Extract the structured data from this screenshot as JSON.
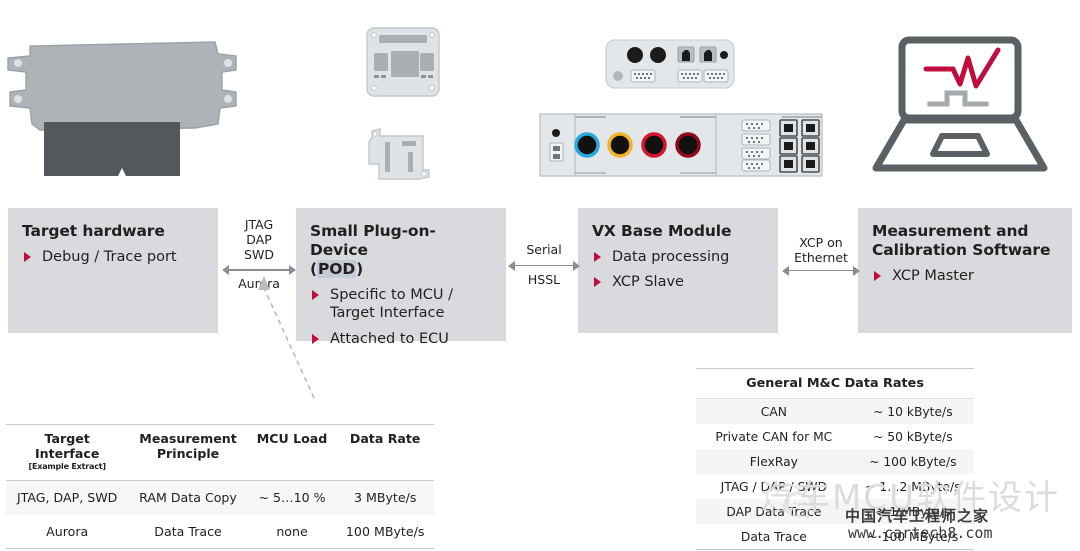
{
  "diagram": {
    "panels": [
      {
        "id": "target-hardware",
        "title": "Target hardware",
        "title_plain": "Target hardware",
        "bullets": [
          "Debug / Trace port"
        ]
      },
      {
        "id": "pod",
        "title_line1": "Small Plug-on-Device",
        "title_line2_pre": "(",
        "title_line2_hl": "POD",
        "title_line2_post": ")",
        "bullets": [
          "Specific to MCU / Target Interface",
          "Attached to ECU"
        ]
      },
      {
        "id": "vx-base-module",
        "title": "VX Base Module",
        "bullets": [
          "Data processing",
          "XCP Slave"
        ]
      },
      {
        "id": "mc-software",
        "title_line1": "Measurement and",
        "title_line2": "Calibration Software",
        "bullets": [
          "XCP Master"
        ]
      }
    ],
    "connectors": [
      {
        "id": "target-to-pod",
        "top": "JTAG\nDAP\nSWD",
        "bottom": "Aurora"
      },
      {
        "id": "pod-to-vx",
        "top": "Serial",
        "bottom": "HSSL"
      },
      {
        "id": "vx-to-software",
        "top": "XCP on",
        "bottom": "Ethernet"
      }
    ]
  },
  "table_interfaces": {
    "headers": [
      {
        "line1": "Target",
        "line2": "Interface",
        "note": "[Example Extract]"
      },
      {
        "line1": "Measurement",
        "line2": "Principle",
        "note": ""
      },
      {
        "line1": "MCU Load",
        "line2": "",
        "note": ""
      },
      {
        "line1": "Data Rate",
        "line2": "",
        "note": ""
      }
    ],
    "rows": [
      {
        "interface": "JTAG, DAP, SWD",
        "principle": "RAM Data Copy",
        "load": "~ 5…10 %",
        "rate": "3 MByte/s"
      },
      {
        "interface": "Aurora",
        "principle": "Data Trace",
        "load": "none",
        "rate": "100 MByte/s"
      }
    ]
  },
  "table_rates": {
    "caption": "General M&C Data Rates",
    "rows": [
      {
        "name": "CAN",
        "rate": "~ 10 kByte/s"
      },
      {
        "name": "Private CAN for MC",
        "rate": "~ 50 kByte/s"
      },
      {
        "name": "FlexRay",
        "rate": "~ 100 kByte/s"
      },
      {
        "name": "JTAG / DAP / SWD",
        "rate": "~ 1…2 MByte/s"
      },
      {
        "name": "DAP Data Trace",
        "rate": "~ 1 MByte/s"
      },
      {
        "name": "Data Trace",
        "rate": "~ 100 MByte/s"
      }
    ]
  },
  "watermark": {
    "big": "汽车MCU软件设计",
    "mid": "中国汽车工程师之家",
    "url": "www.cartech8.com"
  },
  "colors": {
    "panel_bg": "#d8dadd",
    "bullet_red": "#bf0d3e",
    "arrow_gray": "#8a8d90",
    "text": "#231f20",
    "device_gray": "#a9afb3",
    "laptop_gray": "#5a6063"
  }
}
